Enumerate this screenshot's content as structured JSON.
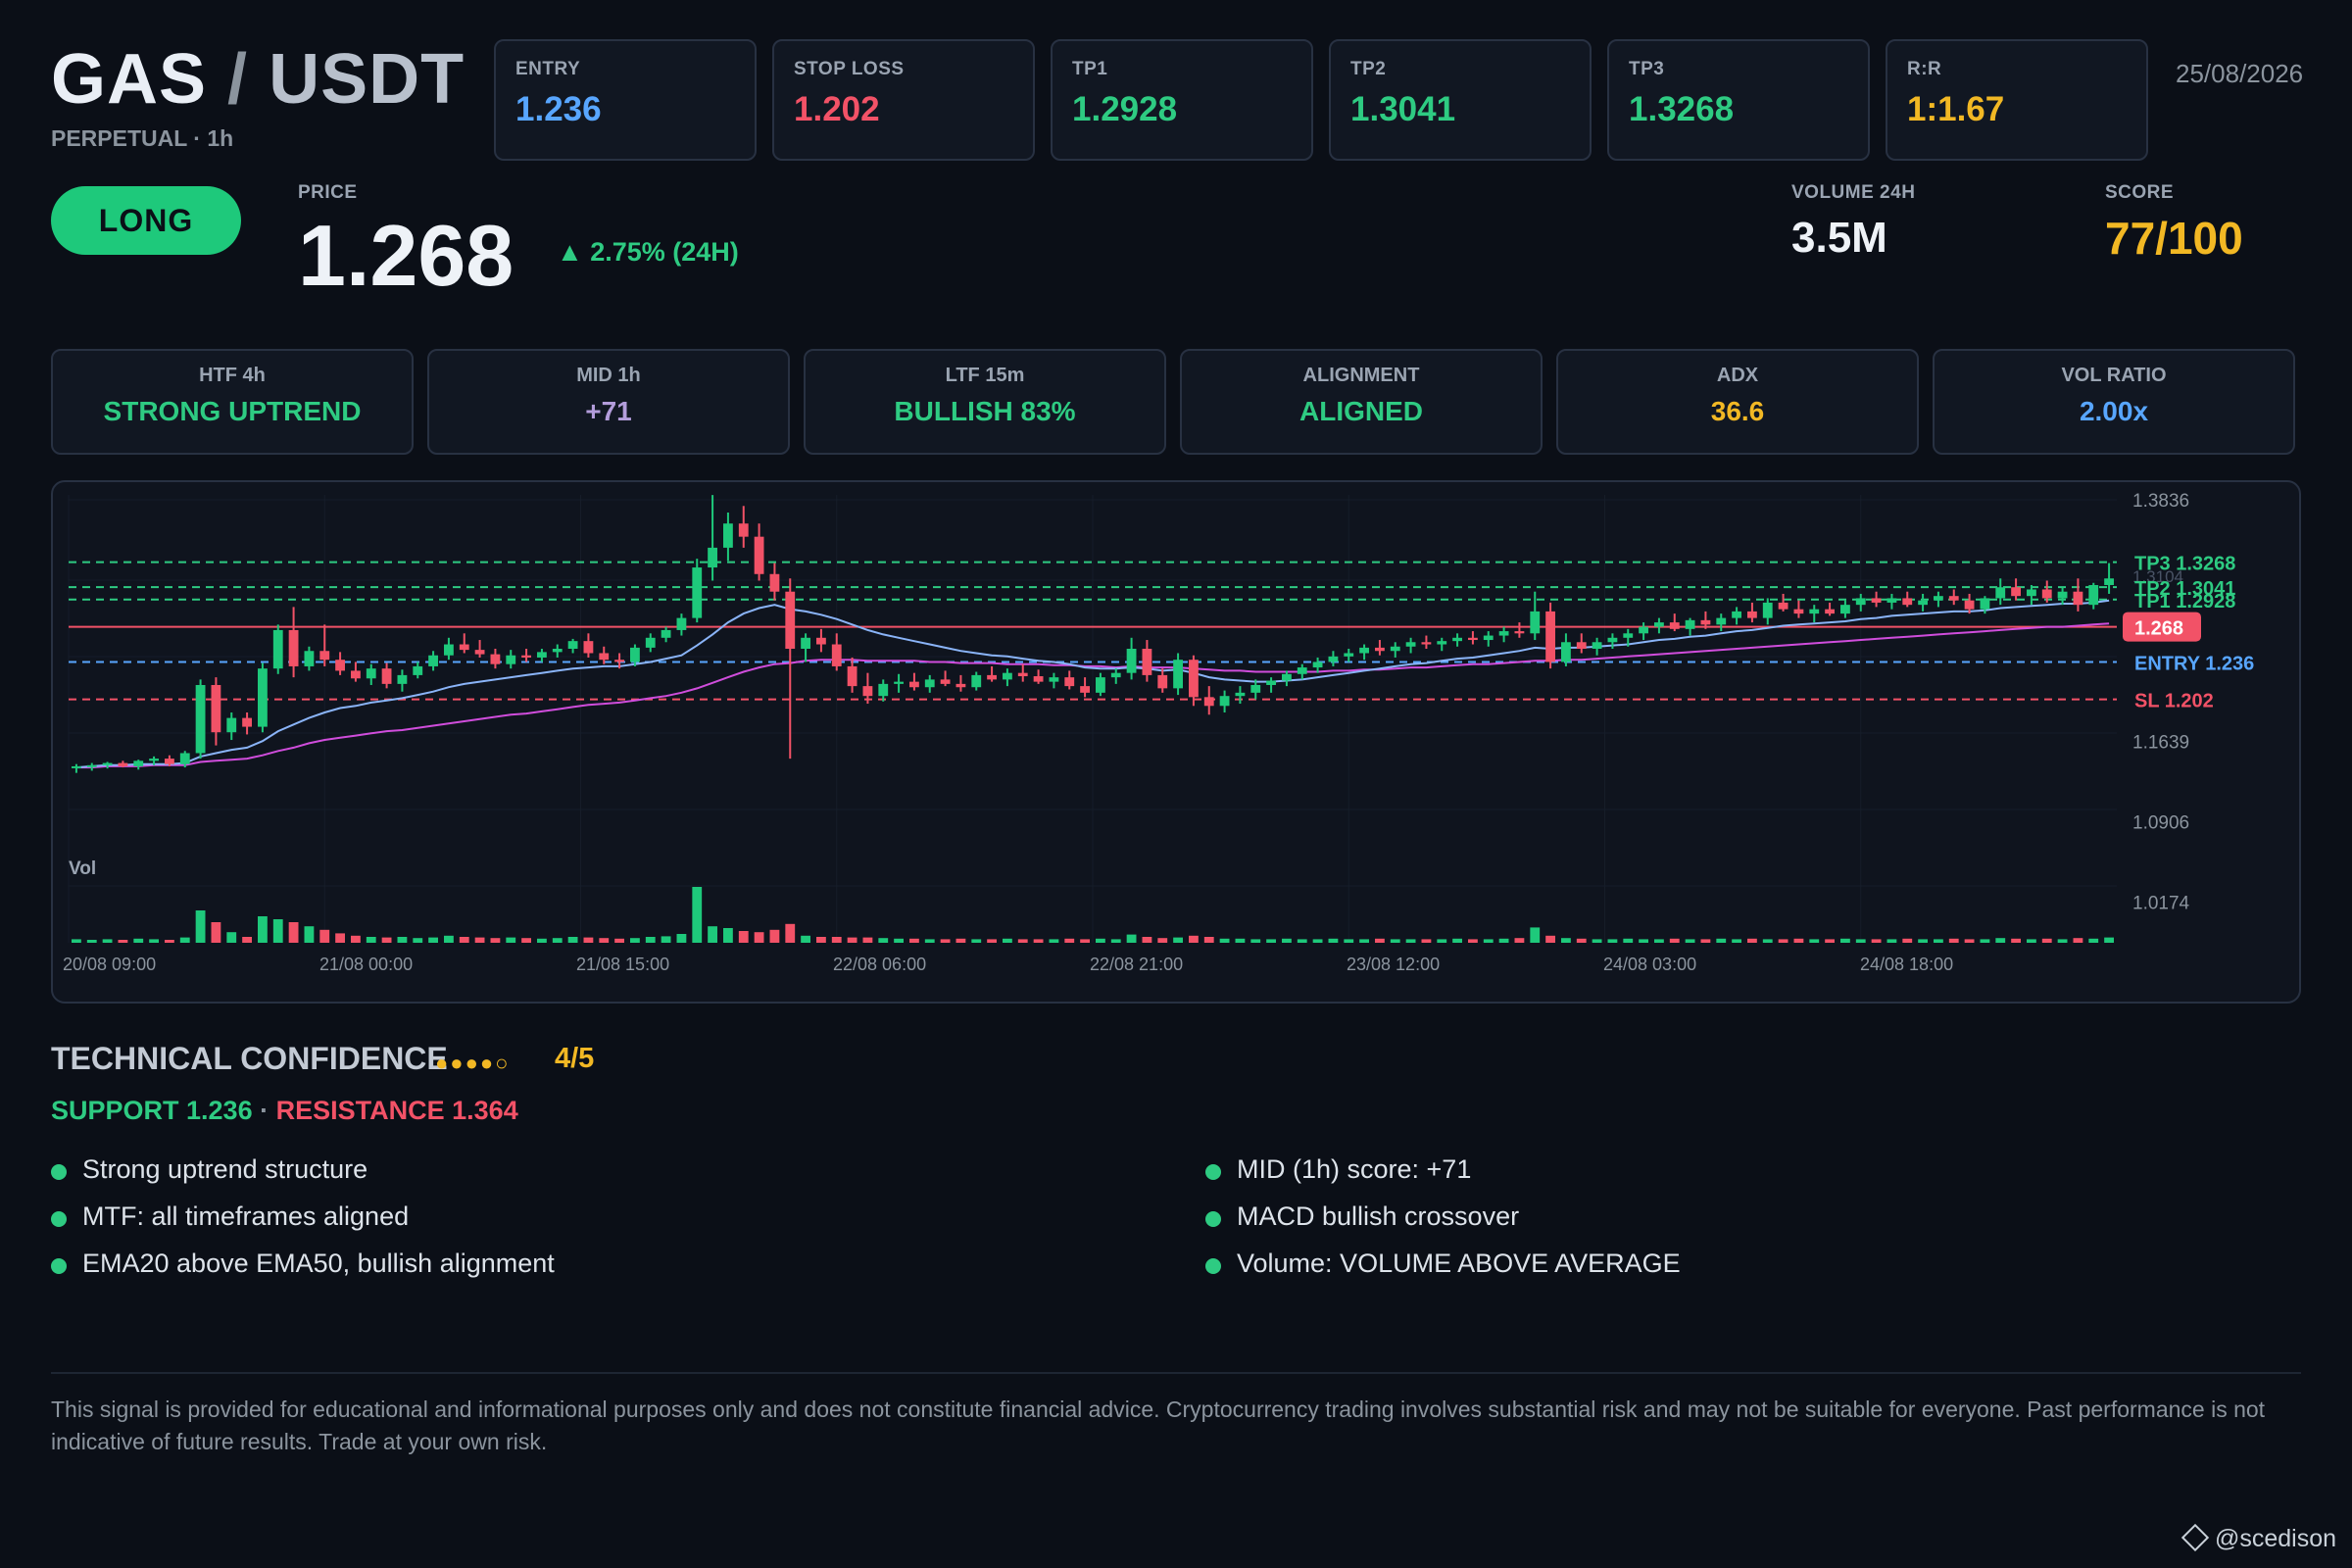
{
  "header": {
    "base": "GAS",
    "slash": "/",
    "quote": "USDT",
    "subtitle": "PERPETUAL · 1h",
    "date": "25/08/2026"
  },
  "stats": [
    {
      "label": "ENTRY",
      "value": "1.236",
      "color": "#58a6ff"
    },
    {
      "label": "STOP LOSS",
      "value": "1.202",
      "color": "#f25267"
    },
    {
      "label": "TP1",
      "value": "1.2928",
      "color": "#2ecb82"
    },
    {
      "label": "TP2",
      "value": "1.3041",
      "color": "#2ecb82"
    },
    {
      "label": "TP3",
      "value": "1.3268",
      "color": "#2ecb82"
    },
    {
      "label": "R:R",
      "value": "1:1.67",
      "color": "#f2b824"
    }
  ],
  "signal": {
    "direction": "LONG",
    "price_label": "PRICE",
    "price": "1.268",
    "change": "▲ 2.75% (24H)",
    "volume_label": "VOLUME 24H",
    "volume": "3.5M",
    "score_label": "SCORE",
    "score": "77/100"
  },
  "timeframes": [
    {
      "label": "HTF 4h",
      "value": "STRONG UPTREND",
      "color": "#2ecb82"
    },
    {
      "label": "MID 1h",
      "value": "+71",
      "color": "#b39ddb"
    },
    {
      "label": "LTF 15m",
      "value": "BULLISH 83%",
      "color": "#2ecb82"
    },
    {
      "label": "ALIGNMENT",
      "value": "ALIGNED",
      "color": "#2ecb82"
    },
    {
      "label": "ADX",
      "value": "36.6",
      "color": "#f2b824"
    },
    {
      "label": "VOL RATIO",
      "value": "2.00x",
      "color": "#58a6ff"
    }
  ],
  "chart_data": {
    "type": "candlestick",
    "x_ticks": [
      "20/08 09:00",
      "21/08 00:00",
      "21/08 15:00",
      "22/08 06:00",
      "22/08 21:00",
      "23/08 12:00",
      "24/08 03:00",
      "24/08 18:00"
    ],
    "y_ticks": [
      "1.3836",
      "1.1639",
      "1.0906",
      "1.0174"
    ],
    "y_range": [
      1.0,
      1.3836
    ],
    "levels": [
      {
        "label": "TP3 1.3268",
        "value": 1.3268,
        "color": "#2ecb82",
        "style": "dashed"
      },
      {
        "label": "TP2 1.3041",
        "value": 1.3041,
        "color": "#2ecb82",
        "style": "dashed"
      },
      {
        "label": "TP1 1.2928",
        "value": 1.2928,
        "color": "#2ecb82",
        "style": "dashed"
      },
      {
        "label": "1.268",
        "value": 1.268,
        "color": "#f25267",
        "style": "solid"
      },
      {
        "label": "ENTRY 1.236",
        "value": 1.236,
        "color": "#58a6ff",
        "style": "dashed"
      },
      {
        "label": "SL 1.202",
        "value": 1.202,
        "color": "#f25267",
        "style": "dashed"
      }
    ],
    "hidden_tick": "1.3104",
    "volume_label": "Vol",
    "ohlc": [
      [
        1.14,
        1.143,
        1.135,
        1.141
      ],
      [
        1.141,
        1.144,
        1.137,
        1.142
      ],
      [
        1.142,
        1.145,
        1.139,
        1.144
      ],
      [
        1.144,
        1.146,
        1.14,
        1.141
      ],
      [
        1.141,
        1.147,
        1.138,
        1.146
      ],
      [
        1.146,
        1.15,
        1.142,
        1.148
      ],
      [
        1.148,
        1.151,
        1.141,
        1.143
      ],
      [
        1.143,
        1.155,
        1.14,
        1.153
      ],
      [
        1.153,
        1.22,
        1.148,
        1.215
      ],
      [
        1.215,
        1.222,
        1.16,
        1.172
      ],
      [
        1.172,
        1.19,
        1.165,
        1.185
      ],
      [
        1.185,
        1.19,
        1.17,
        1.177
      ],
      [
        1.177,
        1.235,
        1.172,
        1.23
      ],
      [
        1.23,
        1.27,
        1.225,
        1.265
      ],
      [
        1.265,
        1.286,
        1.222,
        1.232
      ],
      [
        1.232,
        1.25,
        1.228,
        1.246
      ],
      [
        1.246,
        1.27,
        1.232,
        1.238
      ],
      [
        1.238,
        1.245,
        1.224,
        1.228
      ],
      [
        1.228,
        1.236,
        1.218,
        1.221
      ],
      [
        1.221,
        1.234,
        1.215,
        1.23
      ],
      [
        1.23,
        1.235,
        1.212,
        1.216
      ],
      [
        1.216,
        1.229,
        1.209,
        1.224
      ],
      [
        1.224,
        1.236,
        1.221,
        1.232
      ],
      [
        1.232,
        1.246,
        1.228,
        1.242
      ],
      [
        1.242,
        1.258,
        1.238,
        1.252
      ],
      [
        1.252,
        1.262,
        1.244,
        1.247
      ],
      [
        1.247,
        1.256,
        1.24,
        1.243
      ],
      [
        1.243,
        1.248,
        1.23,
        1.234
      ],
      [
        1.234,
        1.247,
        1.23,
        1.242
      ],
      [
        1.242,
        1.248,
        1.236,
        1.24
      ],
      [
        1.24,
        1.248,
        1.236,
        1.245
      ],
      [
        1.245,
        1.252,
        1.24,
        1.248
      ],
      [
        1.248,
        1.257,
        1.244,
        1.255
      ],
      [
        1.255,
        1.262,
        1.24,
        1.244
      ],
      [
        1.244,
        1.25,
        1.234,
        1.238
      ],
      [
        1.238,
        1.244,
        1.23,
        1.236
      ],
      [
        1.236,
        1.252,
        1.232,
        1.249
      ],
      [
        1.249,
        1.262,
        1.245,
        1.258
      ],
      [
        1.258,
        1.268,
        1.254,
        1.265
      ],
      [
        1.265,
        1.28,
        1.26,
        1.276
      ],
      [
        1.276,
        1.33,
        1.272,
        1.322
      ],
      [
        1.322,
        1.388,
        1.31,
        1.34
      ],
      [
        1.34,
        1.372,
        1.328,
        1.362
      ],
      [
        1.362,
        1.378,
        1.34,
        1.35
      ],
      [
        1.35,
        1.362,
        1.31,
        1.316
      ],
      [
        1.316,
        1.326,
        1.292,
        1.3
      ],
      [
        1.3,
        1.312,
        1.148,
        1.248
      ],
      [
        1.248,
        1.262,
        1.236,
        1.258
      ],
      [
        1.258,
        1.266,
        1.245,
        1.252
      ],
      [
        1.252,
        1.262,
        1.228,
        1.232
      ],
      [
        1.232,
        1.24,
        1.208,
        1.214
      ],
      [
        1.214,
        1.226,
        1.198,
        1.205
      ],
      [
        1.205,
        1.22,
        1.2,
        1.216
      ],
      [
        1.216,
        1.225,
        1.208,
        1.218
      ],
      [
        1.218,
        1.226,
        1.21,
        1.213
      ],
      [
        1.213,
        1.224,
        1.208,
        1.22
      ],
      [
        1.22,
        1.228,
        1.214,
        1.216
      ],
      [
        1.216,
        1.224,
        1.209,
        1.213
      ],
      [
        1.213,
        1.227,
        1.21,
        1.224
      ],
      [
        1.224,
        1.232,
        1.218,
        1.22
      ],
      [
        1.22,
        1.23,
        1.214,
        1.226
      ],
      [
        1.226,
        1.234,
        1.218,
        1.223
      ],
      [
        1.223,
        1.229,
        1.216,
        1.218
      ],
      [
        1.218,
        1.226,
        1.212,
        1.222
      ],
      [
        1.222,
        1.228,
        1.211,
        1.214
      ],
      [
        1.214,
        1.222,
        1.204,
        1.208
      ],
      [
        1.208,
        1.226,
        1.205,
        1.222
      ],
      [
        1.222,
        1.23,
        1.216,
        1.226
      ],
      [
        1.226,
        1.258,
        1.22,
        1.248
      ],
      [
        1.248,
        1.256,
        1.218,
        1.224
      ],
      [
        1.224,
        1.23,
        1.208,
        1.212
      ],
      [
        1.212,
        1.244,
        1.206,
        1.238
      ],
      [
        1.238,
        1.242,
        1.196,
        1.204
      ],
      [
        1.204,
        1.214,
        1.188,
        1.196
      ],
      [
        1.196,
        1.21,
        1.19,
        1.205
      ],
      [
        1.205,
        1.214,
        1.198,
        1.208
      ],
      [
        1.208,
        1.22,
        1.202,
        1.215
      ],
      [
        1.215,
        1.222,
        1.208,
        1.219
      ],
      [
        1.219,
        1.228,
        1.214,
        1.225
      ],
      [
        1.225,
        1.234,
        1.22,
        1.231
      ],
      [
        1.231,
        1.24,
        1.226,
        1.236
      ],
      [
        1.236,
        1.246,
        1.232,
        1.241
      ],
      [
        1.241,
        1.248,
        1.236,
        1.244
      ],
      [
        1.244,
        1.252,
        1.238,
        1.249
      ],
      [
        1.249,
        1.256,
        1.242,
        1.246
      ],
      [
        1.246,
        1.254,
        1.24,
        1.25
      ],
      [
        1.25,
        1.258,
        1.244,
        1.254
      ],
      [
        1.254,
        1.26,
        1.248,
        1.252
      ],
      [
        1.252,
        1.258,
        1.246,
        1.255
      ],
      [
        1.255,
        1.262,
        1.25,
        1.258
      ],
      [
        1.258,
        1.264,
        1.252,
        1.256
      ],
      [
        1.256,
        1.264,
        1.25,
        1.26
      ],
      [
        1.26,
        1.268,
        1.254,
        1.264
      ],
      [
        1.264,
        1.272,
        1.258,
        1.262
      ],
      [
        1.262,
        1.3,
        1.256,
        1.282
      ],
      [
        1.282,
        1.29,
        1.23,
        1.236
      ],
      [
        1.236,
        1.262,
        1.232,
        1.254
      ],
      [
        1.254,
        1.262,
        1.244,
        1.248
      ],
      [
        1.248,
        1.258,
        1.242,
        1.254
      ],
      [
        1.254,
        1.262,
        1.248,
        1.258
      ],
      [
        1.258,
        1.266,
        1.25,
        1.262
      ],
      [
        1.262,
        1.272,
        1.256,
        1.268
      ],
      [
        1.268,
        1.276,
        1.262,
        1.272
      ],
      [
        1.272,
        1.28,
        1.264,
        1.266
      ],
      [
        1.266,
        1.276,
        1.26,
        1.274
      ],
      [
        1.274,
        1.282,
        1.266,
        1.27
      ],
      [
        1.27,
        1.28,
        1.264,
        1.276
      ],
      [
        1.276,
        1.286,
        1.27,
        1.282
      ],
      [
        1.282,
        1.29,
        1.272,
        1.276
      ],
      [
        1.276,
        1.294,
        1.27,
        1.29
      ],
      [
        1.29,
        1.298,
        1.282,
        1.284
      ],
      [
        1.284,
        1.292,
        1.276,
        1.28
      ],
      [
        1.28,
        1.288,
        1.272,
        1.284
      ],
      [
        1.284,
        1.29,
        1.278,
        1.28
      ],
      [
        1.28,
        1.292,
        1.276,
        1.288
      ],
      [
        1.288,
        1.298,
        1.282,
        1.294
      ],
      [
        1.294,
        1.3,
        1.286,
        1.29
      ],
      [
        1.29,
        1.298,
        1.284,
        1.294
      ],
      [
        1.294,
        1.3,
        1.286,
        1.288
      ],
      [
        1.288,
        1.298,
        1.282,
        1.292
      ],
      [
        1.292,
        1.3,
        1.286,
        1.296
      ],
      [
        1.296,
        1.302,
        1.288,
        1.292
      ],
      [
        1.292,
        1.298,
        1.28,
        1.284
      ],
      [
        1.284,
        1.296,
        1.28,
        1.294
      ],
      [
        1.294,
        1.312,
        1.288,
        1.304
      ],
      [
        1.304,
        1.312,
        1.292,
        1.296
      ],
      [
        1.296,
        1.306,
        1.288,
        1.302
      ],
      [
        1.302,
        1.31,
        1.29,
        1.294
      ],
      [
        1.294,
        1.304,
        1.288,
        1.3
      ],
      [
        1.3,
        1.312,
        1.282,
        1.288
      ],
      [
        1.288,
        1.308,
        1.284,
        1.306
      ],
      [
        1.306,
        1.326,
        1.298,
        1.312
      ]
    ],
    "ema20": [
      1.14,
      1.141,
      1.142,
      1.142,
      1.143,
      1.143,
      1.143,
      1.144,
      1.15,
      1.153,
      1.156,
      1.158,
      1.164,
      1.173,
      1.179,
      1.185,
      1.19,
      1.194,
      1.196,
      1.199,
      1.201,
      1.203,
      1.206,
      1.209,
      1.213,
      1.216,
      1.218,
      1.22,
      1.222,
      1.224,
      1.226,
      1.228,
      1.23,
      1.231,
      1.232,
      1.232,
      1.234,
      1.236,
      1.239,
      1.242,
      1.251,
      1.261,
      1.272,
      1.28,
      1.285,
      1.288,
      1.284,
      1.282,
      1.279,
      1.275,
      1.27,
      1.265,
      1.261,
      1.258,
      1.255,
      1.252,
      1.249,
      1.246,
      1.244,
      1.242,
      1.241,
      1.239,
      1.237,
      1.236,
      1.234,
      1.231,
      1.23,
      1.23,
      1.231,
      1.23,
      1.228,
      1.229,
      1.226,
      1.222,
      1.22,
      1.219,
      1.218,
      1.218,
      1.219,
      1.22,
      1.222,
      1.224,
      1.226,
      1.228,
      1.23,
      1.232,
      1.234,
      1.235,
      1.237,
      1.239,
      1.24,
      1.242,
      1.244,
      1.246,
      1.249,
      1.248,
      1.249,
      1.249,
      1.25,
      1.251,
      1.252,
      1.254,
      1.256,
      1.257,
      1.259,
      1.26,
      1.262,
      1.264,
      1.265,
      1.267,
      1.269,
      1.27,
      1.271,
      1.272,
      1.273,
      1.275,
      1.276,
      1.278,
      1.279,
      1.28,
      1.281,
      1.282,
      1.282,
      1.283,
      1.285,
      1.286,
      1.287,
      1.288,
      1.289,
      1.289,
      1.29,
      1.292
    ],
    "ema50": [
      1.14,
      1.14,
      1.141,
      1.141,
      1.141,
      1.142,
      1.142,
      1.142,
      1.145,
      1.146,
      1.147,
      1.148,
      1.151,
      1.155,
      1.158,
      1.162,
      1.165,
      1.167,
      1.169,
      1.171,
      1.173,
      1.174,
      1.176,
      1.178,
      1.18,
      1.182,
      1.184,
      1.186,
      1.188,
      1.189,
      1.191,
      1.193,
      1.195,
      1.197,
      1.198,
      1.199,
      1.201,
      1.203,
      1.205,
      1.208,
      1.212,
      1.217,
      1.222,
      1.227,
      1.231,
      1.234,
      1.235,
      1.237,
      1.238,
      1.238,
      1.238,
      1.237,
      1.237,
      1.237,
      1.237,
      1.236,
      1.236,
      1.235,
      1.235,
      1.235,
      1.234,
      1.234,
      1.234,
      1.233,
      1.233,
      1.232,
      1.232,
      1.231,
      1.232,
      1.231,
      1.231,
      1.231,
      1.23,
      1.229,
      1.228,
      1.228,
      1.227,
      1.227,
      1.227,
      1.227,
      1.227,
      1.228,
      1.228,
      1.229,
      1.229,
      1.23,
      1.231,
      1.231,
      1.232,
      1.233,
      1.234,
      1.234,
      1.235,
      1.236,
      1.237,
      1.237,
      1.238,
      1.238,
      1.239,
      1.24,
      1.241,
      1.242,
      1.243,
      1.244,
      1.245,
      1.246,
      1.247,
      1.248,
      1.249,
      1.25,
      1.251,
      1.252,
      1.253,
      1.254,
      1.255,
      1.256,
      1.257,
      1.258,
      1.259,
      1.26,
      1.261,
      1.262,
      1.263,
      1.264,
      1.265,
      1.266,
      1.267,
      1.268,
      1.268,
      1.269,
      1.27,
      1.271
    ],
    "volume": [
      0.06,
      0.05,
      0.06,
      0.05,
      0.07,
      0.06,
      0.05,
      0.09,
      0.55,
      0.35,
      0.18,
      0.1,
      0.45,
      0.4,
      0.35,
      0.28,
      0.22,
      0.16,
      0.12,
      0.1,
      0.09,
      0.1,
      0.08,
      0.09,
      0.12,
      0.1,
      0.09,
      0.08,
      0.09,
      0.08,
      0.07,
      0.08,
      0.1,
      0.09,
      0.08,
      0.07,
      0.08,
      0.1,
      0.11,
      0.15,
      0.95,
      0.28,
      0.25,
      0.2,
      0.18,
      0.22,
      0.32,
      0.12,
      0.1,
      0.1,
      0.09,
      0.09,
      0.08,
      0.07,
      0.07,
      0.06,
      0.06,
      0.07,
      0.06,
      0.06,
      0.07,
      0.06,
      0.06,
      0.06,
      0.07,
      0.06,
      0.07,
      0.06,
      0.14,
      0.1,
      0.08,
      0.09,
      0.12,
      0.1,
      0.07,
      0.07,
      0.06,
      0.06,
      0.07,
      0.06,
      0.06,
      0.07,
      0.06,
      0.06,
      0.07,
      0.06,
      0.06,
      0.06,
      0.06,
      0.07,
      0.06,
      0.06,
      0.07,
      0.08,
      0.26,
      0.12,
      0.08,
      0.07,
      0.06,
      0.06,
      0.07,
      0.06,
      0.06,
      0.07,
      0.06,
      0.06,
      0.07,
      0.06,
      0.07,
      0.06,
      0.06,
      0.07,
      0.06,
      0.06,
      0.07,
      0.06,
      0.06,
      0.06,
      0.07,
      0.06,
      0.06,
      0.07,
      0.06,
      0.06,
      0.08,
      0.07,
      0.06,
      0.07,
      0.06,
      0.08,
      0.07,
      0.09
    ]
  },
  "confidence": {
    "title": "TECHNICAL CONFIDENCE",
    "dots": "●●●●○",
    "score": "4/5",
    "support": "SUPPORT 1.236",
    "separator": "·",
    "resistance": "RESISTANCE 1.364"
  },
  "reasons_left": [
    "Strong uptrend structure",
    "MTF: all timeframes aligned",
    "EMA20 above EMA50, bullish alignment"
  ],
  "reasons_right": [
    "MID (1h) score: +71",
    "MACD bullish crossover",
    "Volume: VOLUME ABOVE AVERAGE"
  ],
  "disclaimer": "This signal is provided for educational and informational purposes only and does not constitute financial advice. Cryptocurrency trading involves substantial risk and may not be suitable for everyone. Past performance is not indicative of future results. Trade at your own risk.",
  "watermark": "@scedison",
  "colors": {
    "bull": "#1ec97b",
    "bear": "#f25267",
    "ema20": "#8ab4f8",
    "ema50": "#d04ddc",
    "entry": "#58a6ff"
  }
}
